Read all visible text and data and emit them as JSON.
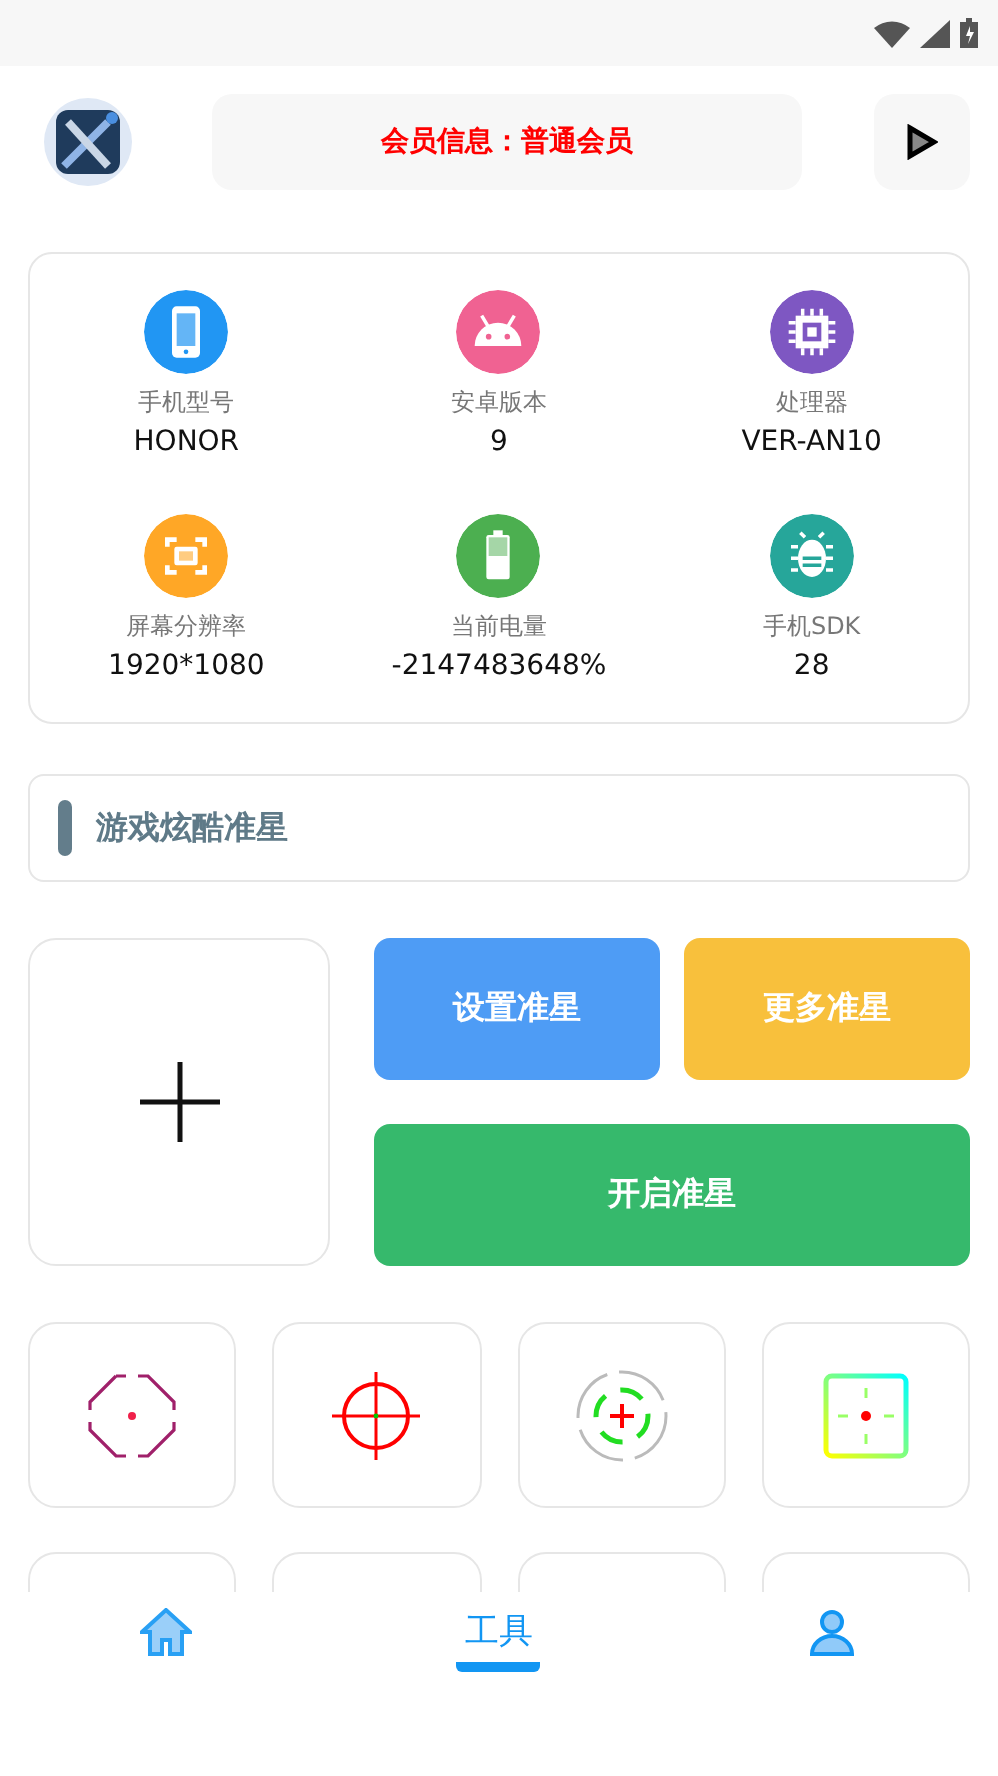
{
  "header": {
    "member_info": "会员信息：普通会员"
  },
  "device_info": [
    {
      "kind": "phone",
      "color": "#2196f3",
      "label": "手机型号",
      "value": "HONOR"
    },
    {
      "kind": "android",
      "color": "#f06292",
      "label": "安卓版本",
      "value": "9"
    },
    {
      "kind": "cpu",
      "color": "#7e57c2",
      "label": "处理器",
      "value": "VER-AN10"
    },
    {
      "kind": "screen",
      "color": "#ffa726",
      "label": "屏幕分辨率",
      "value": "1920*1080"
    },
    {
      "kind": "battery",
      "color": "#4caf50",
      "label": "当前电量",
      "value": "-2147483648%"
    },
    {
      "kind": "sdk",
      "color": "#26a69a",
      "label": "手机SDK",
      "value": "28"
    }
  ],
  "section_title": "游戏炫酷准星",
  "actions": [
    {
      "label": "设置准星",
      "color": "#4e9cf5"
    },
    {
      "label": "更多准星",
      "color": "#f8c03c"
    },
    {
      "label": "开启准星",
      "color": "#36b96c"
    }
  ],
  "crosshairs": [
    {
      "kind": "octagon"
    },
    {
      "kind": "scope"
    },
    {
      "kind": "rings"
    },
    {
      "kind": "square"
    },
    {
      "kind": "empty"
    },
    {
      "kind": "empty"
    },
    {
      "kind": "empty"
    },
    {
      "kind": "empty"
    }
  ],
  "nav": [
    {
      "kind": "home",
      "selected": false
    },
    {
      "kind": "text",
      "label": "工具",
      "selected": true
    },
    {
      "kind": "user",
      "selected": false
    }
  ]
}
